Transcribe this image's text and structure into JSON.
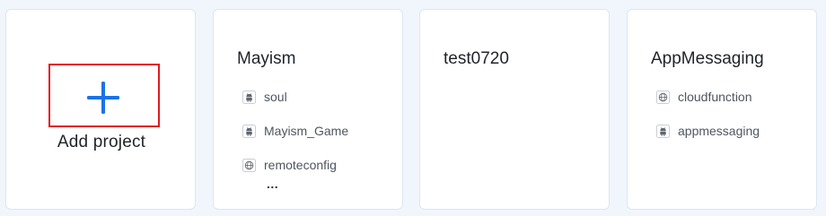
{
  "add_card": {
    "label": "Add project",
    "icon": "plus-icon",
    "accent_color": "#1a73e8",
    "highlight_color": "#e0191f"
  },
  "projects": [
    {
      "name": "Mayism",
      "apps": [
        {
          "name": "soul",
          "icon": "android-icon"
        },
        {
          "name": "Mayism_Game",
          "icon": "android-icon"
        },
        {
          "name": "remoteconfig",
          "icon": "web-icon"
        }
      ],
      "more": "..."
    },
    {
      "name": "test0720",
      "apps": []
    },
    {
      "name": "AppMessaging",
      "apps": [
        {
          "name": "cloudfunction",
          "icon": "web-icon"
        },
        {
          "name": "appmessaging",
          "icon": "android-icon"
        }
      ]
    }
  ]
}
